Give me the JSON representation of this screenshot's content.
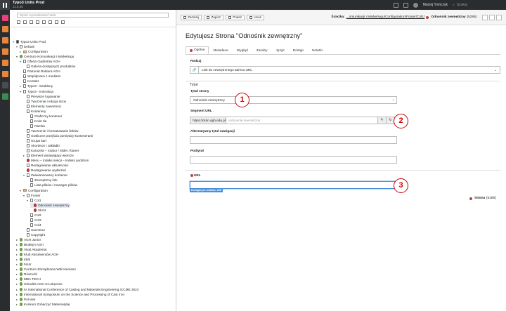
{
  "topbar": {
    "site_title": "Typo3 Units Prod",
    "version": "11.5.30",
    "user": "Maciej Tomczyk",
    "search_placeholder": "Szukaj"
  },
  "tree": {
    "search_placeholder": "Wpisz wyszukiwane hasło",
    "nodes": [
      {
        "label": "Typo3 Units Prod",
        "icon": "site",
        "expand": "▾"
      },
      {
        "label": "Default",
        "icon": "page",
        "expand": "▾"
      },
      {
        "label": "Configuration",
        "icon": "folder",
        "expand": "▸"
      },
      {
        "label": "Centrum Komunikacji i Marketingu",
        "icon": "green",
        "expand": "▾"
      },
      {
        "label": "Oferta Gadżetów AGH",
        "icon": "page",
        "expand": "▾"
      },
      {
        "label": "Galeria dostępnych produktów",
        "icon": "page",
        "expand": ""
      },
      {
        "label": "Patronat Rektora AGH",
        "icon": "page",
        "expand": ""
      },
      {
        "label": "Współpraca z mediami",
        "icon": "page",
        "expand": ""
      },
      {
        "label": "Kontakt",
        "icon": "page",
        "expand": ""
      },
      {
        "label": "Typo3 - Szablony",
        "icon": "page",
        "expand": "▸"
      },
      {
        "label": "Typo3 - Instrukcja",
        "icon": "page",
        "expand": "▾"
      },
      {
        "label": "Pierwsze logowanie",
        "icon": "page",
        "expand": ""
      },
      {
        "label": "Tworzenie i edycja stron",
        "icon": "page",
        "expand": ""
      },
      {
        "label": "Elementy zawartości",
        "icon": "page",
        "expand": ""
      },
      {
        "label": "Kontenery",
        "icon": "page",
        "expand": ""
      },
      {
        "label": "Graficzny kontener",
        "icon": "page",
        "expand": ""
      },
      {
        "label": "Kolor tła",
        "icon": "page",
        "expand": ""
      },
      {
        "label": "Ramka",
        "icon": "page",
        "expand": ""
      },
      {
        "label": "Tworzenie i formatowanie linków",
        "icon": "page",
        "expand": ""
      },
      {
        "label": "Graficzne przejścia pomiędzy kontenerami",
        "icon": "page",
        "expand": ""
      },
      {
        "label": "Grupa kart",
        "icon": "page",
        "expand": ""
      },
      {
        "label": "Akordeon i zakładki",
        "icon": "page",
        "expand": ""
      },
      {
        "label": "Karuzela – rotator / slider / baner",
        "icon": "page",
        "expand": ""
      },
      {
        "label": "Element wstawiający wiersze",
        "icon": "page",
        "expand": "▸"
      },
      {
        "label": "Menu – Indeks sekcji – Indeks podstron",
        "icon": "red",
        "expand": ""
      },
      {
        "label": "Redagowanie aktualności",
        "icon": "page",
        "expand": ""
      },
      {
        "label": "Redagowanie wydarzeń",
        "icon": "red",
        "expand": ""
      },
      {
        "label": "Zaawansowany kontener",
        "icon": "page",
        "expand": "▾"
      },
      {
        "label": "Zewnętrzny link",
        "icon": "page",
        "expand": ""
      },
      {
        "label": "Lista plików / manager plików",
        "icon": "page",
        "expand": ""
      },
      {
        "label": "Configuration",
        "icon": "folder",
        "expand": "▾"
      },
      {
        "label": "Footer",
        "icon": "page",
        "expand": "▾"
      },
      {
        "label": "Col1",
        "icon": "page",
        "expand": "▾"
      },
      {
        "label": "Odnośnik zewnętrzny",
        "icon": "red",
        "expand": ""
      },
      {
        "label": "Skrót",
        "icon": "red",
        "expand": ""
      },
      {
        "label": "Col2",
        "icon": "page",
        "expand": ""
      },
      {
        "label": "Col3",
        "icon": "page",
        "expand": ""
      },
      {
        "label": "Col4",
        "icon": "page",
        "expand": ""
      },
      {
        "label": "Socmenu",
        "icon": "page",
        "expand": ""
      },
      {
        "label": "Copyright",
        "icon": "page",
        "expand": ""
      },
      {
        "label": "AGH Junior",
        "icon": "green",
        "expand": "▸"
      },
      {
        "label": "Biuletyn AGH",
        "icon": "green",
        "expand": "▸"
      },
      {
        "label": "Vivat Akademia",
        "icon": "green",
        "expand": "▸"
      },
      {
        "label": "Klub Absolwentów AGH",
        "icon": "green",
        "expand": "▸"
      },
      {
        "label": "Idub",
        "icon": "green",
        "expand": "▸"
      },
      {
        "label": "hrs4r",
        "icon": "green",
        "expand": "▸"
      },
      {
        "label": "Centrum Zarządzania Wdrożeniami",
        "icon": "green",
        "expand": "▸"
      },
      {
        "label": "Równość",
        "icon": "green",
        "expand": "▸"
      },
      {
        "label": "MBA TECH",
        "icon": "green",
        "expand": "▸"
      },
      {
        "label": "Ośrodek AGH w Łukęcinie",
        "icon": "green",
        "expand": "▸"
      },
      {
        "label": "IV International Conference of Casting and Materials Engineering ICCME 2023",
        "icon": "green",
        "expand": "▸"
      },
      {
        "label": "International Symposium on the Science and Processing of Cast Iron",
        "icon": "green",
        "expand": "▸"
      },
      {
        "label": "Pol-Viet",
        "icon": "green",
        "expand": "▸"
      },
      {
        "label": "Konkurs Zobaczyć Matematykę",
        "icon": "green",
        "expand": "▸"
      }
    ]
  },
  "toolbar": {
    "close": "Zamknij",
    "save": "Zapisz",
    "view": "Pokaż",
    "delete": "Usuń",
    "path_label": "Ścieżka:",
    "path": "...omunikacji i Marketingu/Configuration/Footer/Col1/",
    "current_page": "Odnośnik zewnętrzny",
    "page_id": "[5285]"
  },
  "form": {
    "title": "Edytujesz Strona \"Odnośnik zewnętrzny\"",
    "tabs": [
      "Ogólne",
      "Metadane",
      "Wygląd",
      "Zasoby",
      "Język",
      "Dostęp",
      "Notatki"
    ],
    "type_label": "Rodzaj",
    "type_value": "Link do zewnętrznego adresu URL",
    "section_title": "Tytuł",
    "page_title_label": "Tytuł strony",
    "page_title_value": "Odnośnik zewnętrzny",
    "slug_label": "Segment URL",
    "slug_prefix": "https://ckim.agh.edu.pl",
    "slug_value": "/odnosnik-zewnetrzny",
    "nav_title_label": "Alternatywny tytuł nawigacji",
    "subtitle_label": "Podtytuł",
    "url_label": "URL",
    "url_value": "",
    "url_hint": "Dostępnych znaków: 255",
    "footer_type": "Strona",
    "footer_id": "[5285]"
  },
  "callouts": [
    "1",
    "2",
    "3"
  ],
  "colors": {
    "topbar": "#2a2d2f",
    "error": "#c83c3c",
    "focus": "#4a90d9",
    "callout": "#cc0000"
  }
}
